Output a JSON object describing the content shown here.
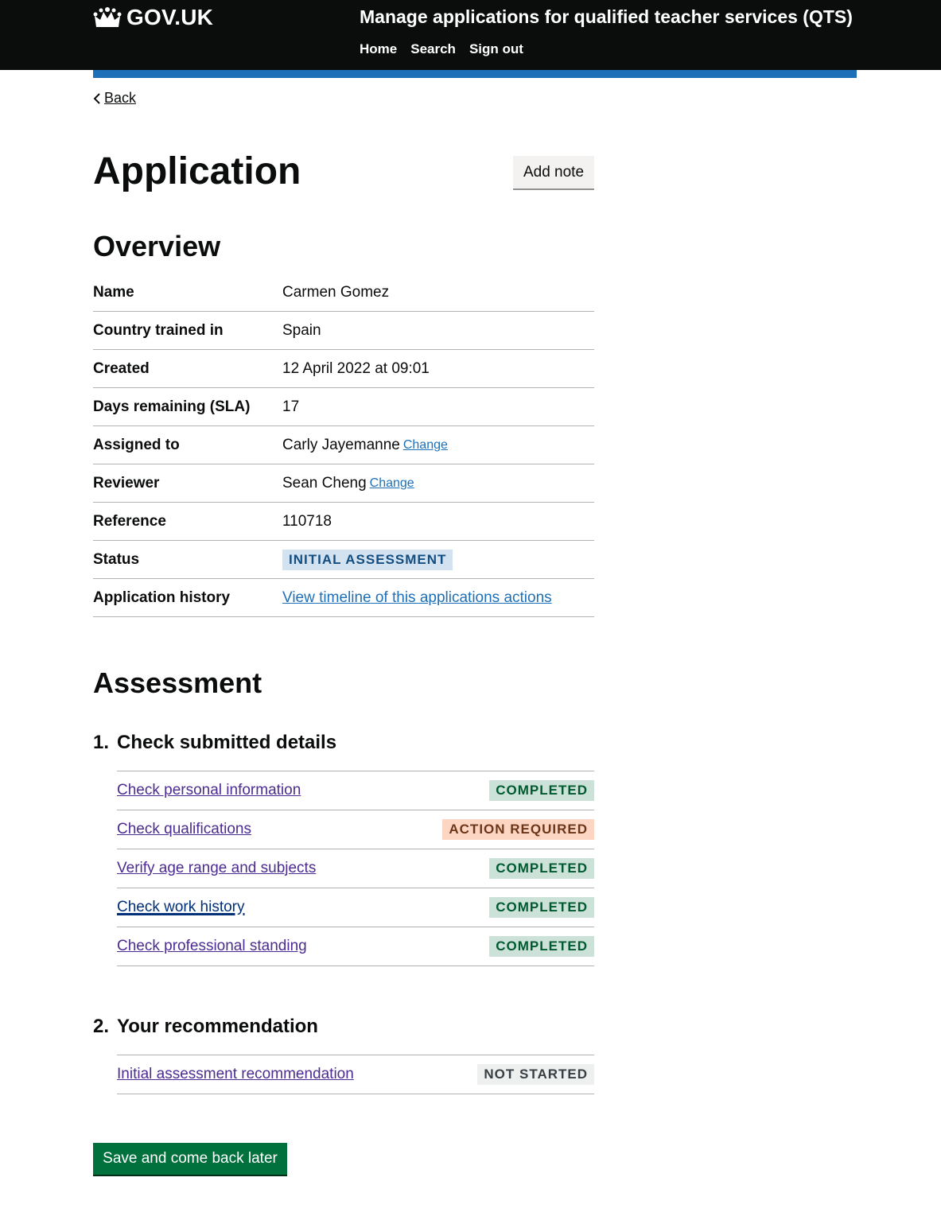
{
  "header": {
    "logo_text": "GOV.UK",
    "service_name": "Manage applications for qualified teacher services (QTS)",
    "nav": [
      "Home",
      "Search",
      "Sign out"
    ]
  },
  "back_label": "Back",
  "page_title": "Application",
  "add_note_label": "Add note",
  "overview": {
    "heading": "Overview",
    "rows": {
      "name": {
        "key": "Name",
        "value": "Carmen Gomez"
      },
      "country": {
        "key": "Country trained in",
        "value": "Spain"
      },
      "created": {
        "key": "Created",
        "value": "12 April 2022 at 09:01"
      },
      "days": {
        "key": "Days remaining (SLA)",
        "value": "17"
      },
      "assigned": {
        "key": "Assigned to",
        "value": "Carly Jayemanne",
        "change": "Change"
      },
      "reviewer": {
        "key": "Reviewer",
        "value": "Sean Cheng",
        "change": "Change"
      },
      "reference": {
        "key": "Reference",
        "value": "110718"
      },
      "status": {
        "key": "Status",
        "value": "INITIAL ASSESSMENT"
      },
      "history": {
        "key": "Application history",
        "link": "View timeline of this applications actions"
      }
    }
  },
  "assessment": {
    "heading": "Assessment",
    "section1": {
      "num": "1.",
      "title": "Check submitted details",
      "tasks": [
        {
          "label": "Check personal information",
          "status": "COMPLETED"
        },
        {
          "label": "Check qualifications",
          "status": "ACTION REQUIRED"
        },
        {
          "label": "Verify age range and subjects",
          "status": "COMPLETED"
        },
        {
          "label": "Check work history",
          "status": "COMPLETED"
        },
        {
          "label": "Check professional standing",
          "status": "COMPLETED"
        }
      ]
    },
    "section2": {
      "num": "2.",
      "title": "Your recommendation",
      "tasks": [
        {
          "label": "Initial assessment recommendation",
          "status": "NOT STARTED"
        }
      ]
    }
  },
  "save_label": "Save and come back later",
  "colors": {
    "header_bg": "#0b0c0c",
    "brand_blue": "#1d70b8",
    "visited_link": "#4c2c92",
    "button_green": "#00703c"
  }
}
